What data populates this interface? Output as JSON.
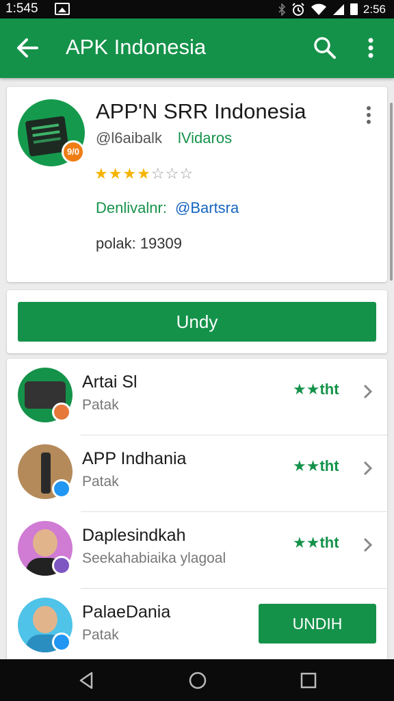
{
  "status_bar": {
    "time_left": "1:545",
    "time_right": "2:56",
    "icons": [
      "bluetooth-icon",
      "alarm-icon",
      "wifi-icon",
      "signal-icon",
      "battery-icon"
    ]
  },
  "app_bar": {
    "title": "APK Indonesia",
    "icons": [
      "back-arrow-icon",
      "search-icon",
      "more-vert-icon"
    ]
  },
  "app_card": {
    "name": "APP'N SRR Indonesia",
    "badge": "9/0",
    "developer_handle": "@l6aibalk",
    "developer_link": "lVidaros",
    "stars": {
      "filled": "★★★★",
      "empty": "☆☆☆"
    },
    "download_label": "Denlivalnr:",
    "download_value": "@Bartsra",
    "count": "polak: 19309"
  },
  "primary_button": {
    "label": "Undy"
  },
  "list": [
    {
      "title": "Artai Sl",
      "subtitle": "Patak",
      "rating": "★★tht",
      "action": "chevron"
    },
    {
      "title": "APP Indhania",
      "subtitle": "Patak",
      "rating": "★★tht",
      "action": "chevron"
    },
    {
      "title": "Daplesindkah",
      "subtitle": "Seekahabiaika ylagoal",
      "rating": "★★tht",
      "action": "chevron"
    },
    {
      "title": "PalaeDania",
      "subtitle": "Patak",
      "action": "install",
      "install_label": "UNDIH"
    }
  ],
  "colors": {
    "brand_green": "#15924a",
    "star_yellow": "#f5b400",
    "link_blue": "#1565c0"
  },
  "nav_bar": {
    "icons": [
      "back-triangle-icon",
      "home-circle-icon",
      "recents-square-icon"
    ]
  }
}
